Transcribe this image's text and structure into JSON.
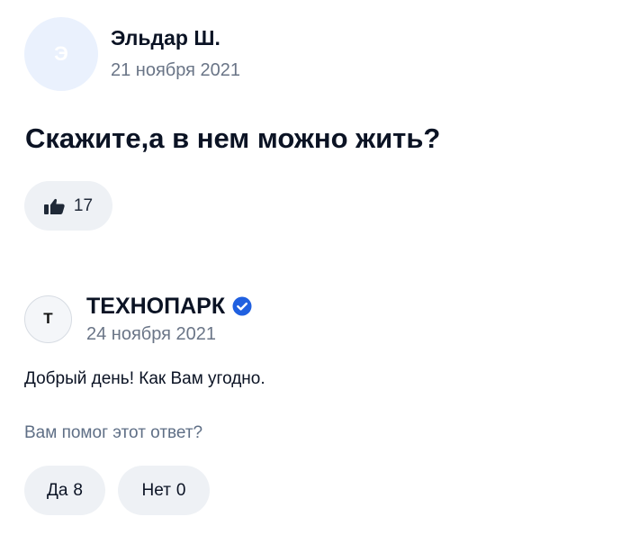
{
  "question": {
    "author_initial": "Э",
    "author_name": "Эльдар Ш.",
    "date": "21 ноября 2021",
    "text": "Скажите,а в нем можно жить?",
    "likes": "17"
  },
  "answer": {
    "author_initial": "T",
    "author_name": "ТЕХНОПАРК",
    "verified": true,
    "date": "24 ноября 2021",
    "text": "Добрый день! Как Вам угодно.",
    "helpful_prompt": "Вам помог этот ответ?",
    "yes_label": "Да",
    "yes_count": "8",
    "no_label": "Нет",
    "no_count": "0"
  },
  "colors": {
    "verified_badge": "#2060e0",
    "pill_bg": "#eef1f5",
    "avatar_bg": "#eaf1fd"
  },
  "icons": {
    "like": "thumbs-up-icon",
    "verified": "verified-check-icon"
  }
}
